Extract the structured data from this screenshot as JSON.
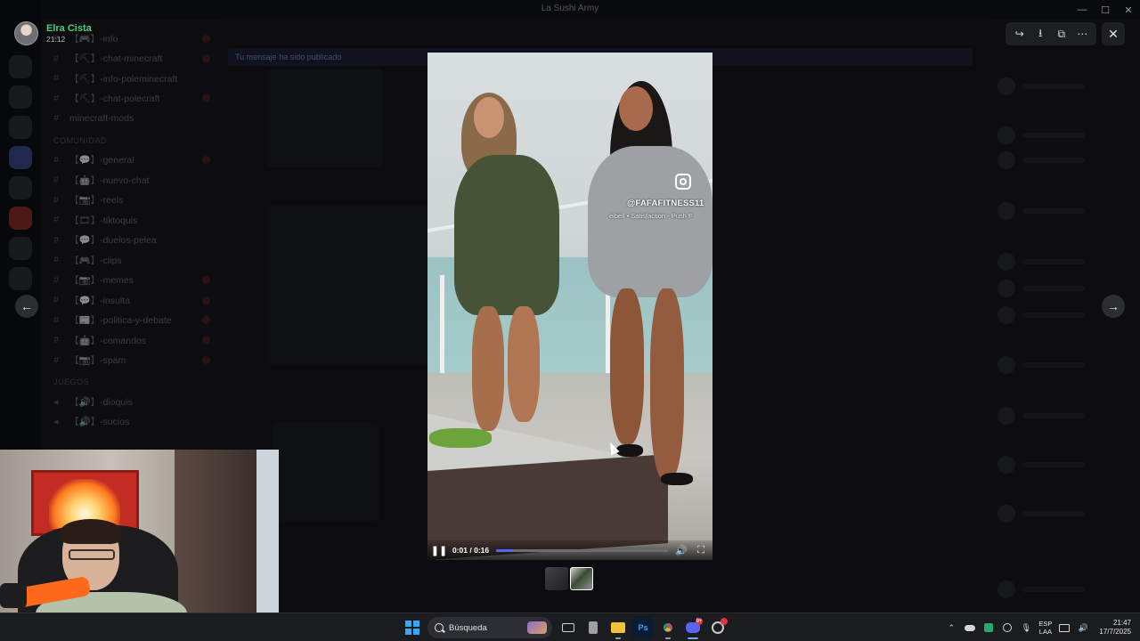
{
  "window": {
    "title": "La Sushi Army",
    "controls": {
      "minimize": "—",
      "maximize": "☐",
      "close": "✕"
    }
  },
  "viewer": {
    "author_name": "Elra Cista",
    "author_time": "21:12",
    "toolbar": {
      "forward_icon": "↪",
      "download_icon": "⭳",
      "open_external_icon": "⧉",
      "more_icon": "⋯"
    },
    "close_icon": "✕",
    "prev_icon": "←",
    "next_icon": "→"
  },
  "background": {
    "server_name": "La Sushi Army",
    "channels": [
      {
        "name": "【🎮】-info"
      },
      {
        "name": "【⛏】-chat-minecraft"
      },
      {
        "name": "【⛏】-info-poleminecraft"
      },
      {
        "name": "【⛏】-chat-polecraft"
      },
      {
        "name": "minecraft-mods"
      }
    ],
    "category": "Comunidad",
    "channels2": [
      {
        "name": "【💬】-general"
      },
      {
        "name": "【🤖】-nuevo-chat"
      },
      {
        "name": "【📷】-reels"
      },
      {
        "name": "【🎞】-tiktoquis"
      },
      {
        "name": "【💬】-duelos-pelea"
      },
      {
        "name": "【🎮】-clips"
      },
      {
        "name": "【📷】-memes"
      },
      {
        "name": "【💬】-insulta"
      },
      {
        "name": "【📰】-politica-y-debate"
      },
      {
        "name": "【🤖】-comandos"
      },
      {
        "name": "【📷】-spam"
      }
    ],
    "category2": "Juegos",
    "channels3": [
      {
        "name": "【🔊】-dioquis"
      },
      {
        "name": "【🔊】-sucios"
      }
    ],
    "banner_text": "Tu mensaje ha sido publicado"
  },
  "video": {
    "watermark_handle": "@FAFAFITNESS11",
    "watermark_song": "elbell • Satisfaction - Push F",
    "current_time": "0:01",
    "duration": "0:16",
    "time_separator": " / ",
    "progress_fraction": 0.1,
    "pause_icon": "❚❚",
    "volume_icon": "🔊",
    "fullscreen_icon": "⛶"
  },
  "taskbar": {
    "search_placeholder": "Búsqueda",
    "discord_badge": "9+",
    "language_line1": "ESP",
    "language_line2": "LAA",
    "clock_time": "21:47",
    "clock_date": "17/7/2025",
    "tray": {
      "chevron_icon": "⌃",
      "mic_icon": "🎙",
      "speaker_icon": "🔊"
    }
  },
  "colors": {
    "accent": "#5865f2",
    "author_green": "#43d17a",
    "windows_blue": "#3aa7f5"
  }
}
